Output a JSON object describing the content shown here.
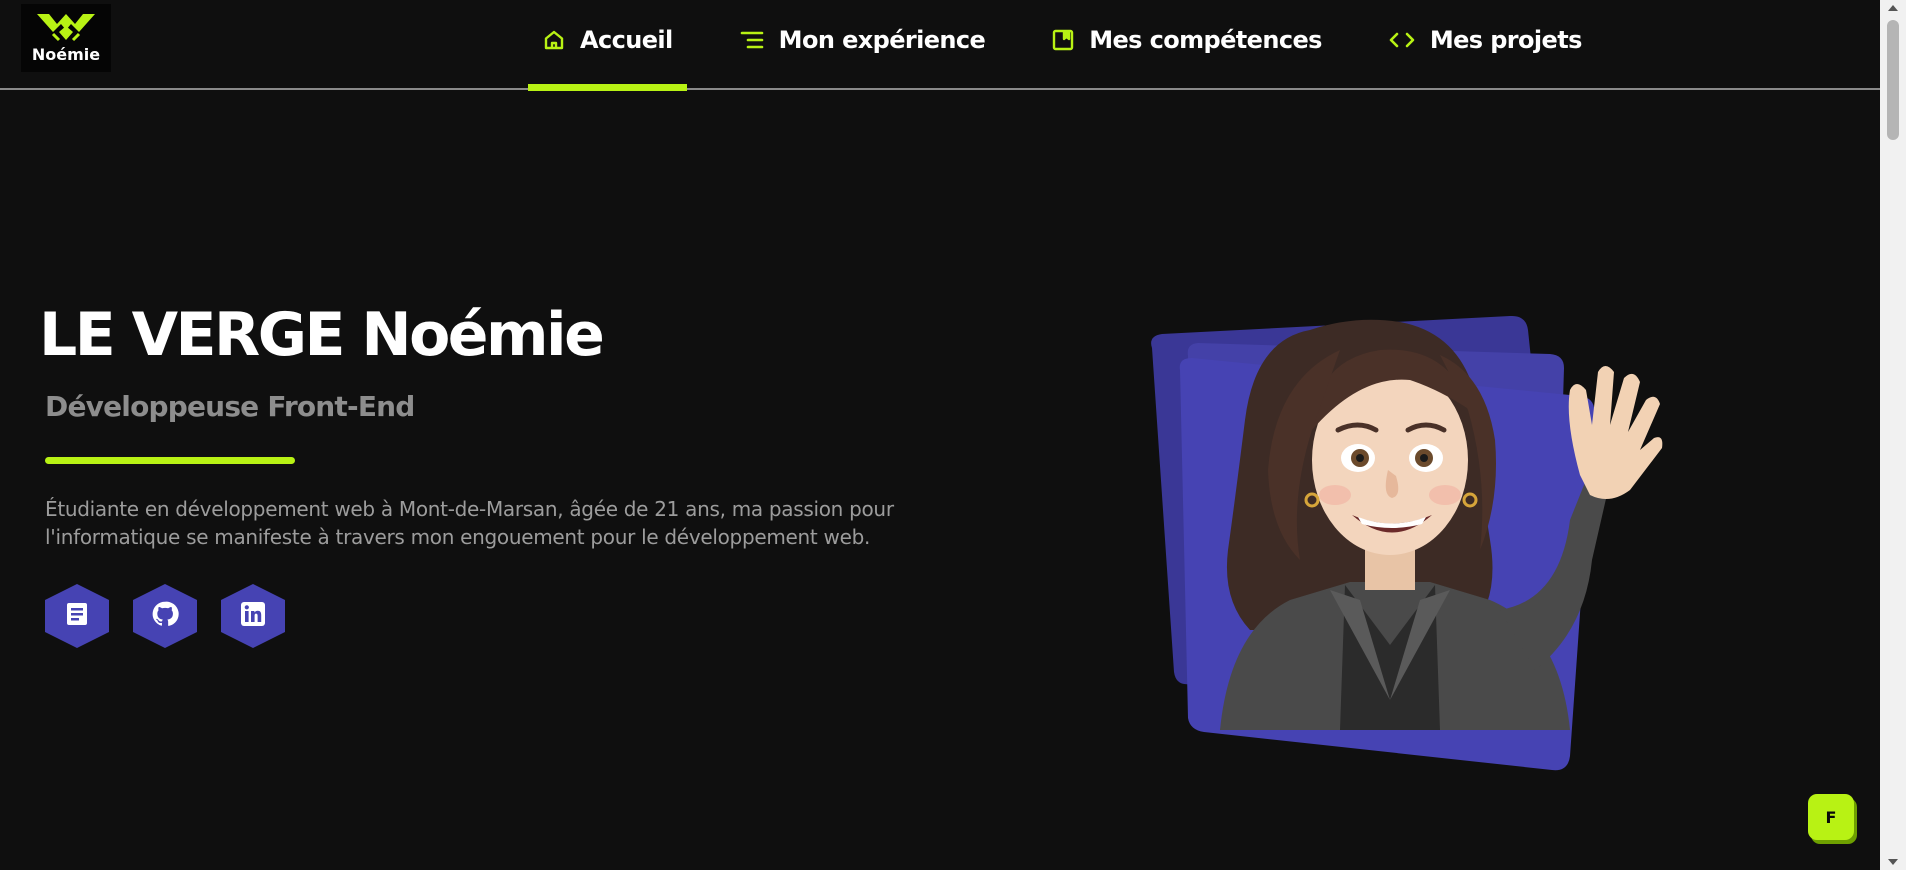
{
  "brand": {
    "logo_text": "Noémie",
    "accent": "#b8f214",
    "hex_color": "#4643b3"
  },
  "nav": {
    "items": [
      {
        "label": "Accueil",
        "icon": "home-icon",
        "active": true
      },
      {
        "label": "Mon expérience",
        "icon": "list-icon",
        "active": false
      },
      {
        "label": "Mes compétences",
        "icon": "bookmark-icon",
        "active": false
      },
      {
        "label": "Mes projets",
        "icon": "code-icon",
        "active": false
      }
    ]
  },
  "hero": {
    "name": "LE VERGE Noémie",
    "role": "Développeuse Front-End",
    "bio": "Étudiante en développement web à Mont-de-Marsan, âgée de 21 ans, ma passion pour l'informatique se manifeste à travers mon engouement pour le développement web.",
    "socials": [
      {
        "name": "cv",
        "icon": "document-icon"
      },
      {
        "name": "github",
        "icon": "github-icon"
      },
      {
        "name": "linkedin",
        "icon": "linkedin-icon"
      }
    ]
  },
  "floating_button": {
    "label": "F"
  }
}
